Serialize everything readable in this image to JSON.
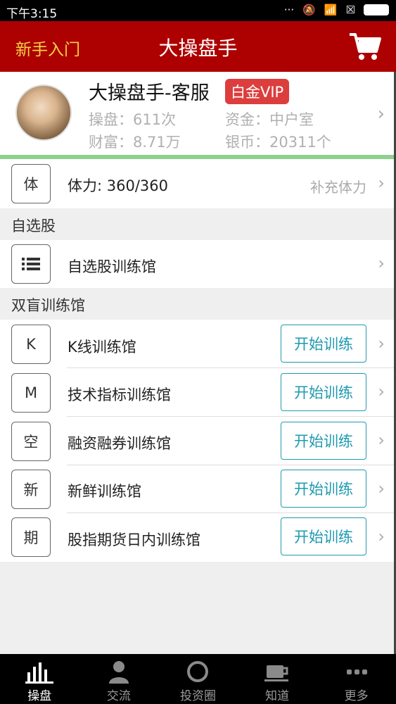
{
  "status": {
    "time": "下午3:15"
  },
  "nav": {
    "left_label": "新手入门",
    "title": "大操盘手"
  },
  "profile": {
    "name": "大操盘手-客服",
    "badge": "白金VIP",
    "trades": "操盘：611次",
    "funds": "资金：中户室",
    "wealth": "财富：8.71万",
    "silver": "银币：20311个"
  },
  "stamina": {
    "box": "体",
    "label": "体力: 360/360",
    "action": "补充体力"
  },
  "watchlist": {
    "header": "自选股",
    "item_label": "自选股训练馆"
  },
  "blind": {
    "header": "双盲训练馆",
    "button_label": "开始训练",
    "items": [
      {
        "box": "K",
        "label": "K线训练馆"
      },
      {
        "box": "M",
        "label": "技术指标训练馆"
      },
      {
        "box": "空",
        "label": "融资融券训练馆"
      },
      {
        "box": "新",
        "label": "新鲜训练馆"
      },
      {
        "box": "期",
        "label": "股指期货日内训练馆"
      }
    ]
  },
  "tabs": [
    {
      "label": "操盘",
      "icon": "bar-chart-icon",
      "active": true
    },
    {
      "label": "交流",
      "icon": "person-icon"
    },
    {
      "label": "投资圈",
      "icon": "circle-icon"
    },
    {
      "label": "知道",
      "icon": "cup-icon"
    },
    {
      "label": "更多",
      "icon": "more-dots-icon"
    }
  ]
}
